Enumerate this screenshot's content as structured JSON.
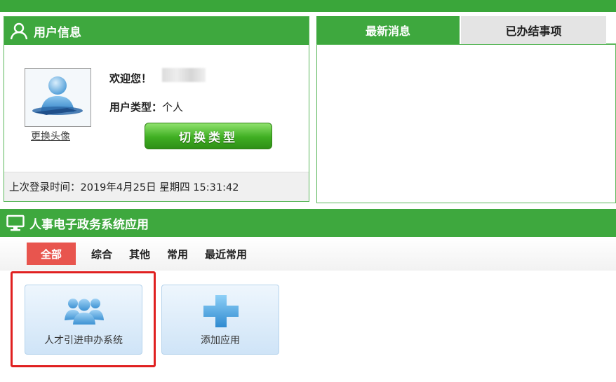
{
  "user_panel": {
    "title": "用户信息",
    "change_avatar": "更换头像",
    "welcome_label": "欢迎您！",
    "user_type_label": "用户类型：",
    "user_type_value": "个人",
    "switch_button": "切换类型",
    "last_login": "上次登录时间：2019年4月25日 星期四 15:31:42"
  },
  "messages": {
    "tabs": [
      "最新消息",
      "已办结事项"
    ]
  },
  "apps": {
    "title": "人事电子政务系统应用",
    "filters": [
      "全部",
      "综合",
      "其他",
      "常用",
      "最近常用"
    ],
    "cards": [
      "人才引进申办系统",
      "添加应用"
    ]
  },
  "colors": {
    "accent_green": "#3ea83e",
    "active_filter_red": "#e8554e",
    "highlight_red": "#e02020"
  }
}
